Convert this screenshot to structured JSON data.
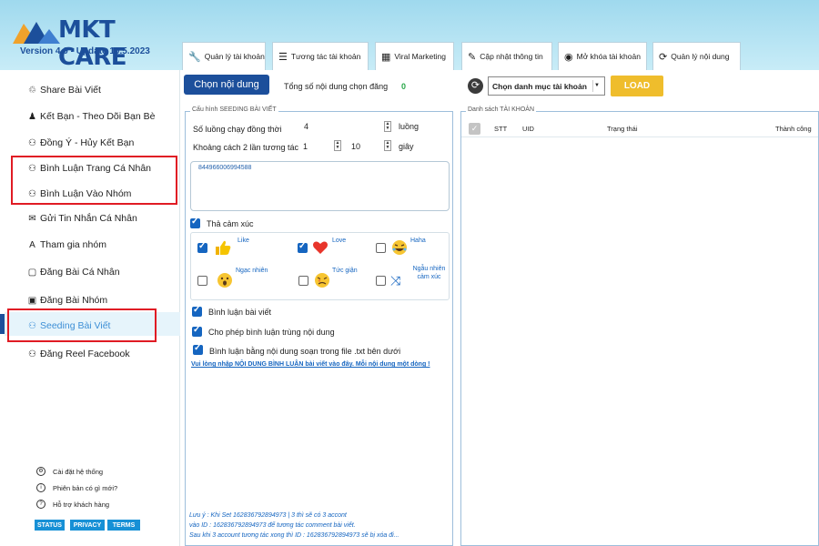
{
  "app": {
    "logo_text": "MKT CARE",
    "version": "Version 4.0 - Update 10.5.2023"
  },
  "tabs": [
    {
      "label": "Quản lý tài khoản",
      "icon": "wrench-icon"
    },
    {
      "label": "Tương tác tài khoản",
      "icon": "list-icon"
    },
    {
      "label": "Viral Marketing",
      "icon": "calculator-icon"
    },
    {
      "label": "Cập nhật thông tin",
      "icon": "pen-icon"
    },
    {
      "label": "Mở khóa tài khoản",
      "icon": "user-circle-icon"
    },
    {
      "label": "Quản lý nội dung",
      "icon": "content-icon"
    }
  ],
  "sidebar": {
    "items": [
      {
        "label": "Share Bài Viết",
        "icon": "share-icon"
      },
      {
        "label": "Kết Bạn - Theo Dõi Bạn Bè",
        "icon": "add-friend-icon"
      },
      {
        "label": "Đồng Ý - Hủy Kết Bạn",
        "icon": "users-icon"
      },
      {
        "label": "Bình Luận Trang Cá Nhân",
        "icon": "users-icon"
      },
      {
        "label": "Bình Luận Vào Nhóm",
        "icon": "users-icon"
      },
      {
        "label": "Gửi Tin Nhắn Cá Nhân",
        "icon": "message-icon"
      },
      {
        "label": "Tham gia nhóm",
        "icon": "join-group-icon"
      },
      {
        "label": "Đăng Bài Cá Nhân",
        "icon": "book-icon"
      },
      {
        "label": "Đăng Bài Nhóm",
        "icon": "group-post-icon"
      },
      {
        "label": "Seeding Bài Viết",
        "icon": "seeding-icon"
      },
      {
        "label": "Đăng Reel Facebook",
        "icon": "users-icon"
      }
    ],
    "active_index": 9,
    "bottom_links": [
      {
        "label": "Cài đặt hệ thống",
        "icon": "gear-icon"
      },
      {
        "label": "Phiên bản có gì mới?",
        "icon": "info-icon"
      },
      {
        "label": "Hỗ trợ khách hàng",
        "icon": "help-icon"
      }
    ],
    "pills": [
      "STATUS",
      "PRIVACY",
      "TERMS"
    ]
  },
  "toolbar": {
    "choose_content": "Chọn nội dung",
    "total_label": "Tổng số nội dung chọn đăng",
    "total_value": "0",
    "account_category": "Chọn danh mục tài khoản",
    "load": "LOAD"
  },
  "config": {
    "title": "Cấu hình SEEDING BÀI VIẾT",
    "threads_label": "Số luồng chạy đồng thời",
    "threads_value": "4",
    "threads_unit": "luồng",
    "interval_label": "Khoảng cách 2 lần tương tác",
    "interval_from": "1",
    "interval_to": "10",
    "interval_unit": "giây",
    "post_ids": "844966006994588",
    "react_label": "Thả cảm xúc",
    "reactions": [
      {
        "label": "Like",
        "checked": true
      },
      {
        "label": "Love",
        "checked": true
      },
      {
        "label": "Haha",
        "checked": false
      },
      {
        "label": "Ngạc nhiên",
        "checked": false
      },
      {
        "label": "Tức giận",
        "checked": false
      },
      {
        "label": "Ngẫu nhiên cảm xúc",
        "checked": false
      }
    ],
    "comment_label": "Bình luận bài viết",
    "allow_dup_label": "Cho phép bình luận trùng nội dung",
    "use_file_label": "Bình luận bằng nội dung soạn trong file .txt bên dưới",
    "link_note": "Vui lòng nhập NỘI DUNG BÌNH LUẬN bài viết vào đây. Mỗi nội dung một dòng !",
    "footer_lines": [
      "Lưu ý : Khi Set 162836792894973 | 3 thì sẽ có 3 accont",
      "vào ID : 162836792894973 để tương tác comment bài viết.",
      "Sau khi 3 account tương tác xong thì ID : 162836792894973 sẽ bị xóa đi..."
    ]
  },
  "accounts": {
    "title": "Danh sách TÀI KHOẢN",
    "columns": [
      "STT",
      "UID",
      "Trạng thái",
      "Thành công"
    ]
  },
  "colors": {
    "brand": "#1c4f9b",
    "accent": "#1565c0",
    "load": "#efbd2c",
    "highlight": "#e01b24"
  }
}
